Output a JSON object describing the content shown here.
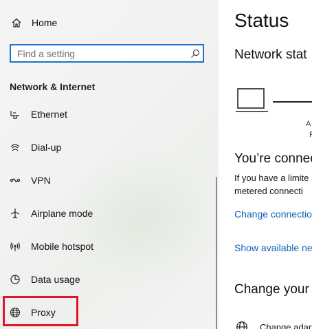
{
  "sidebar": {
    "home_label": "Home",
    "search_placeholder": "Find a setting",
    "section_title": "Network & Internet",
    "items": [
      {
        "label": "Ethernet",
        "icon": "ethernet-icon"
      },
      {
        "label": "Dial-up",
        "icon": "dial-up-icon"
      },
      {
        "label": "VPN",
        "icon": "vpn-icon"
      },
      {
        "label": "Airplane mode",
        "icon": "airplane-icon"
      },
      {
        "label": "Mobile hotspot",
        "icon": "hotspot-icon"
      },
      {
        "label": "Data usage",
        "icon": "data-usage-icon"
      },
      {
        "label": "Proxy",
        "icon": "globe-icon"
      }
    ]
  },
  "main": {
    "title": "Status",
    "network_status_heading": "Network stat",
    "diagram_label_1": "A",
    "diagram_label_2": "P",
    "connected_heading": "You’re connect",
    "info_line_1": "If you have a limite",
    "info_line_2": "metered connecti",
    "change_connection_link": "Change connectio",
    "show_available_link": "Show available ne",
    "change_your_heading": "Change your",
    "change_adapter_text": "Change adap"
  },
  "colors": {
    "accent": "#1a73c9",
    "link": "#0a63b8",
    "highlight": "#e0142a"
  }
}
